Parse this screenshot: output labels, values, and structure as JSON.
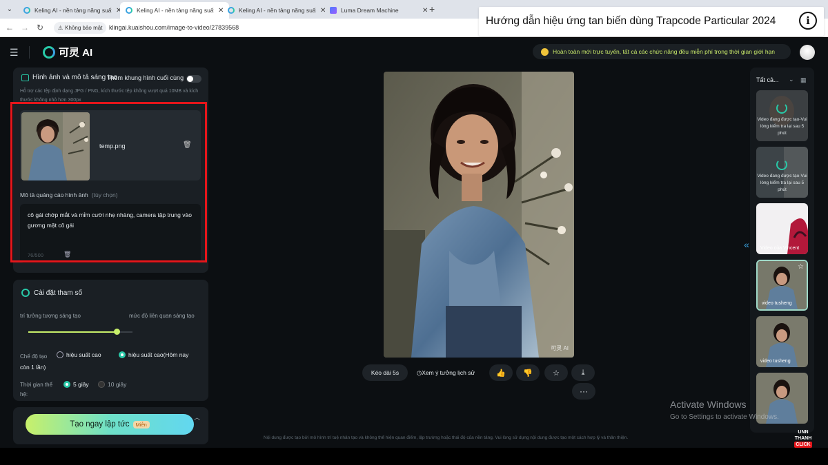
{
  "browser": {
    "tabs": [
      {
        "title": "Keling AI - nền tảng năng suất",
        "icon": "kling-icon"
      },
      {
        "title": "Keling AI - nền tảng năng suất",
        "icon": "kling-icon"
      },
      {
        "title": "Keling AI - nền tảng năng suất",
        "icon": "kling-icon"
      },
      {
        "title": "Luma Dream Machine",
        "icon": "luma-icon"
      }
    ],
    "close_glyph": "✕",
    "new_tab_glyph": "+",
    "security_label": "Không bảo mật",
    "url": "klingai.kuaishou.com/image-to-video/27839568"
  },
  "overlay": {
    "title": "Hướng dẫn hiệu ứng tan biến dùng Trapcode Particular 2024",
    "info_glyph": "i"
  },
  "header": {
    "logo_text": "可灵 AI",
    "promo_text": "Hoàn toàn mới trực tuyến, tất cả các chức năng đều miễn phí trong thời gian giới hạn"
  },
  "upload": {
    "section_title": "Hình ảnh và mô tả sáng tạo",
    "overlap_label": "Thêm khung hình cuối cùng",
    "support_text": "Hỗ trợ các tệp định dạng JPG / PNG, kích thước tệp không vượt quá 10MB và kích thước không nhỏ hơn 300px",
    "file_name": "temp.png",
    "desc_label": "Mô tả quảng cáo hình ảnh",
    "desc_optional": "(tùy chọn)",
    "prompt": "cô gái chớp mắt và mỉm cười nhẹ nhàng, camera tập trung vào gương mặt cô gái",
    "counter": "76/500"
  },
  "params": {
    "title": "Cài đặt tham số",
    "slider_left_label": "trí tưởng tượng sáng tạo",
    "slider_right_label": "mức độ liên quan sáng tạo",
    "slider_value": 0.85,
    "mode_label": "Chế độ tạo",
    "mode_option_1": "hiệu suất cao",
    "mode_option_2": "hiệu suất cao(Hôm nay",
    "mode_option_2_cont": "còn 1 lần)",
    "duration_label": "Thời gian thể hệ:",
    "duration_option_1": "5 giây",
    "duration_option_2": "10 giây"
  },
  "generate": {
    "label": "Tạo ngay lập tức",
    "badge": "Miễn"
  },
  "preview": {
    "watermark": "可灵 AI",
    "extend_label": "Kéo dài 5s",
    "history_label": "Xem ý tưởng lịch sử",
    "disclaimer": "Nội dung được tạo bởi mô hình trí tuệ nhân tạo và không thể hiện quan điểm, lập trường hoặc thái độ của nền tảng. Vui lòng sử dụng nội dung được tạo một cách hợp lý và thân thiện."
  },
  "history": {
    "filter_label": "Tất cả...",
    "items": [
      {
        "caption": "Video đang được tạo-Vui lòng kiểm tra lại sau 5 phút",
        "state": "processing"
      },
      {
        "caption": "Video đang được tạo-Vui lòng kiểm tra lại sau 5 phút",
        "state": "processing"
      },
      {
        "caption": "Video của Vincent",
        "state": "done"
      },
      {
        "caption": "video tusheng",
        "state": "selected"
      },
      {
        "caption": "video tusheng",
        "state": "done"
      },
      {
        "caption": "",
        "state": "done"
      }
    ]
  },
  "os": {
    "activate_title": "Activate Windows",
    "activate_sub": "Go to Settings to activate Windows."
  },
  "channel_logo": {
    "line1": "UNN",
    "line2": "THANH",
    "line3": "CLICK"
  },
  "colors": {
    "accent_teal": "#28c9a8",
    "accent_lime": "#c8f06a",
    "highlight_red": "#e5161b",
    "panel_bg": "#1a1f24",
    "app_bg": "#0c0f12"
  }
}
